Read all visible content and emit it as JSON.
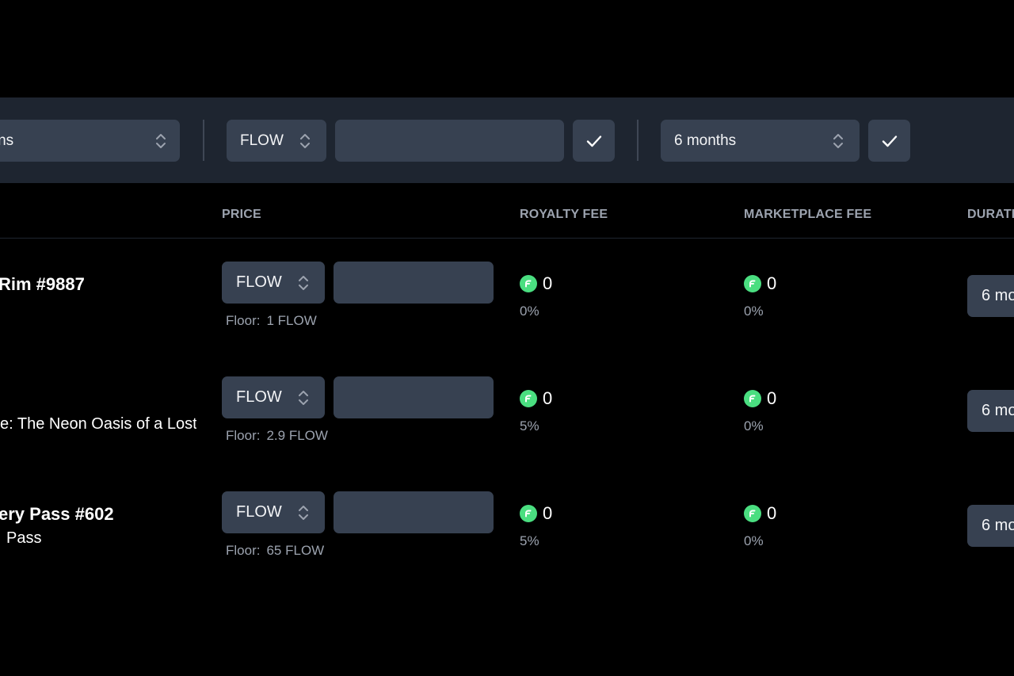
{
  "toolbar": {
    "collection_select": "tions",
    "currency_select": "FLOW",
    "price_input_value": "",
    "duration_select": "6 months"
  },
  "table": {
    "headers": {
      "price": "PRICE",
      "royalty_fee": "ROYALTY FEE",
      "marketplace_fee": "MARKETPLACE FEE",
      "duration": "DURATI"
    },
    "rows": [
      {
        "title": "Rim #9887",
        "subtitle": "",
        "currency": "FLOW",
        "price": "",
        "floor_label": "Floor:",
        "floor_value": "1 FLOW",
        "royalty_amount": "0",
        "royalty_pct": "0%",
        "marketplace_amount": "0",
        "marketplace_pct": "0%",
        "duration": "6 mo"
      },
      {
        "title": "",
        "subtitle": "e: The Neon Oasis of a Lost",
        "currency": "FLOW",
        "price": "",
        "floor_label": "Floor:",
        "floor_value": "2.9 FLOW",
        "royalty_amount": "0",
        "royalty_pct": "5%",
        "marketplace_amount": "0",
        "marketplace_pct": "0%",
        "duration": "6 mo"
      },
      {
        "title": "ery Pass #602",
        "subtitle": "Pass",
        "currency": "FLOW",
        "price": "",
        "floor_label": "Floor:",
        "floor_value": "65 FLOW",
        "royalty_amount": "0",
        "royalty_pct": "5%",
        "marketplace_amount": "0",
        "marketplace_pct": "0%",
        "duration": "6 mo"
      }
    ]
  },
  "icons": {
    "select_chevron": "chevron-up-down-icon",
    "confirm": "check-icon",
    "token": "flow-coin-icon"
  },
  "colors": {
    "background": "#000000",
    "toolbar": "#1e2530",
    "control": "#374151",
    "accent_green": "#4ade80",
    "muted_text": "#9ca3af"
  }
}
